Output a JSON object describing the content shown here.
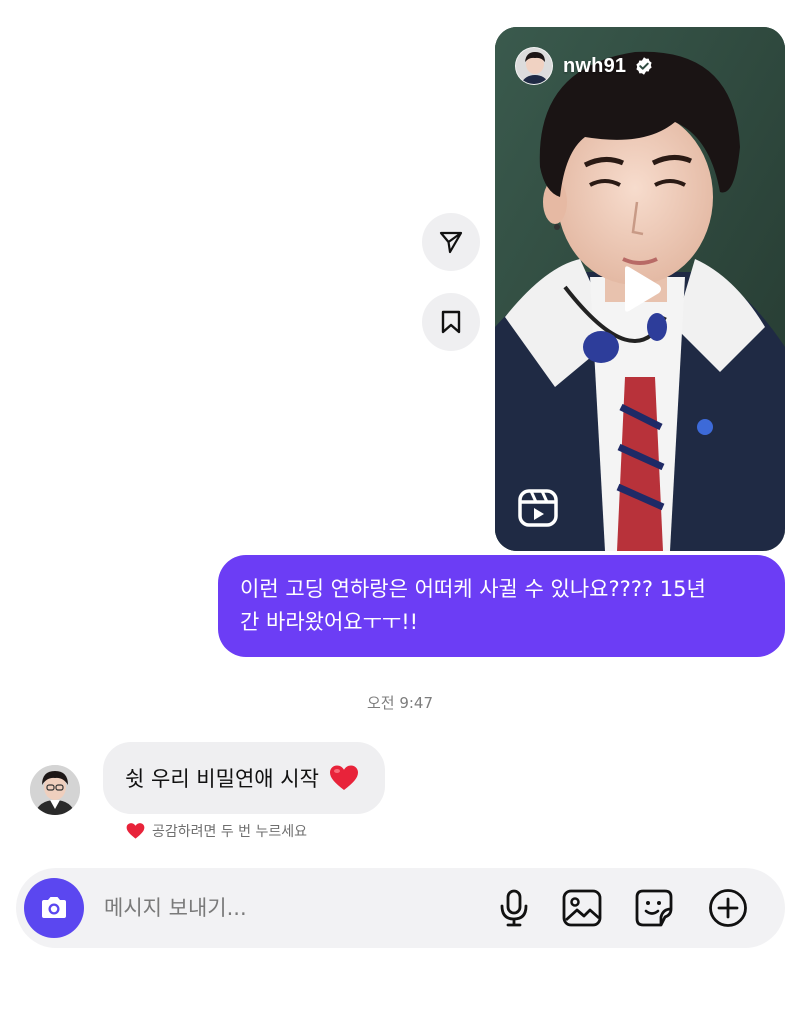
{
  "shared_reel": {
    "username": "nwh91",
    "verified": true,
    "avatar_icon": "profile-photo",
    "media_icon": "play-icon",
    "type_icon": "reels-icon"
  },
  "side_actions": {
    "share_icon": "paper-plane-icon",
    "save_icon": "bookmark-icon"
  },
  "messages": {
    "outgoing": {
      "line1": "이런 고딩 연하랑은 어떠케 사귈 수 있나요???? 15년",
      "line2": "간 바라왔어요ㅜㅜ!!"
    },
    "timestamp": "오전 9:47",
    "incoming": {
      "text": "쉿 우리 비밀연애 시작",
      "emoji": "heart-icon"
    },
    "reaction_hint": "공감하려면 두 번 누르세요"
  },
  "composer": {
    "placeholder": "메시지 보내기...",
    "value": "",
    "icons": [
      "camera-icon",
      "microphone-icon",
      "gallery-icon",
      "sticker-icon",
      "plus-icon"
    ]
  },
  "colors": {
    "outgoing_bubble": "#6c3df5",
    "incoming_bubble": "#efeff1",
    "camera_button": "#5b47f0",
    "heart": "#e8233a"
  }
}
